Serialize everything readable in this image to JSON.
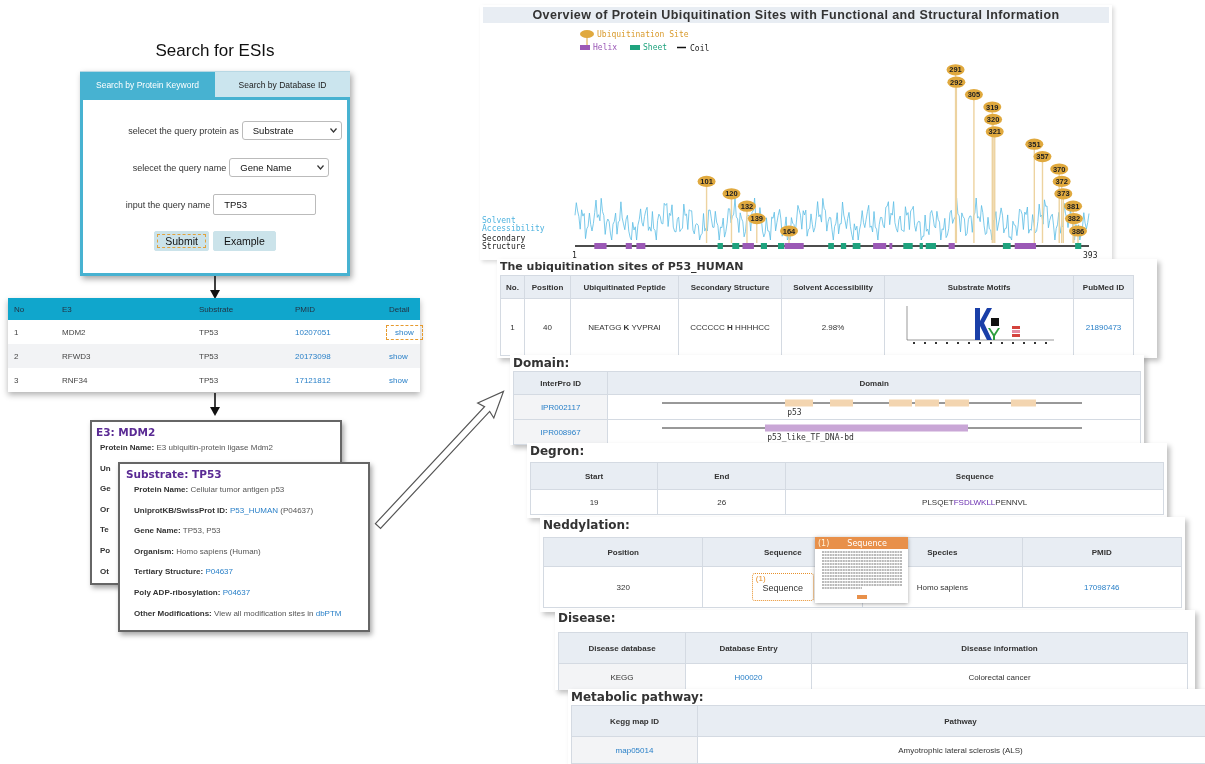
{
  "figure_title": "Search for ESIs",
  "search_panel": {
    "tabs": [
      {
        "label": "Search by Protein Keyword",
        "selected": true
      },
      {
        "label": "Search by Database ID",
        "selected": false
      }
    ],
    "fields": [
      {
        "kind": "select",
        "label": "selecet the query protein as",
        "value": "Substrate"
      },
      {
        "kind": "select",
        "label": "selecet the query name",
        "value": "Gene Name"
      },
      {
        "kind": "input",
        "label": "input the query name",
        "value": "TP53"
      }
    ],
    "buttons": [
      {
        "label": "Submit",
        "highlighted": true
      },
      {
        "label": "Example",
        "highlighted": false
      }
    ]
  },
  "results_table": {
    "columns": [
      "No",
      "E3",
      "Substrate",
      "PMID",
      "Detail"
    ],
    "rows": [
      [
        "1",
        "MDM2",
        "TP53",
        {
          "kind": "link",
          "text": "10207051",
          "highlighted": false
        },
        {
          "kind": "link",
          "text": "show",
          "highlighted": true
        }
      ],
      [
        "2",
        "RFWD3",
        "TP53",
        {
          "kind": "link",
          "text": "20173098",
          "highlighted": false
        },
        {
          "kind": "link",
          "text": "show",
          "highlighted": false
        }
      ],
      [
        "3",
        "RNF34",
        "TP53",
        {
          "kind": "link",
          "text": "17121812",
          "highlighted": false
        },
        {
          "kind": "link",
          "text": "show",
          "highlighted": false
        }
      ]
    ]
  },
  "cards": [
    {
      "title": "E3: MDM2",
      "fields": [
        {
          "label": "Protein Name:",
          "value": "E3 ubiquitin-protein ligase Mdm2"
        },
        {
          "label": "Un"
        },
        {
          "label": "Ge"
        },
        {
          "label": "Or"
        },
        {
          "label": "Te"
        },
        {
          "label": "Po"
        },
        {
          "label": "Ot"
        }
      ]
    },
    {
      "title": "Substrate: TP53",
      "fields": [
        {
          "label": "Protein Name:",
          "value": "Cellular tumor antigen p53"
        },
        {
          "label": "UniprotKB/SwissProt ID:",
          "link": "P53_HUMAN",
          "suffix": "(P04637)"
        },
        {
          "label": "Gene Name:",
          "value": "TP53, P53"
        },
        {
          "label": "Organism:",
          "value": "Homo sapiens (Human)"
        },
        {
          "label": "Tertiary Structure:",
          "link": "P04637"
        },
        {
          "label": "Poly ADP-ribosylation:",
          "link": "P04637"
        },
        {
          "label": "Other Modifications:",
          "value": "View all modification sites in",
          "link": "dbPTM"
        }
      ]
    }
  ],
  "chart": {
    "title": "Overview of Protein Ubiquitination Sites with Functional and Structural Information",
    "legend": [
      {
        "kind": "site",
        "label": "Ubiquitination Site"
      },
      {
        "kind": "helix",
        "label": "Helix"
      },
      {
        "kind": "sheet",
        "label": "Sheet"
      },
      {
        "kind": "coil",
        "label": "Coil"
      }
    ],
    "y_labels": [
      {
        "kind": "accessibility",
        "label": "Solvent Accessibility"
      },
      {
        "kind": "structure",
        "label": "Secondary Structure"
      }
    ],
    "axis_start": "1",
    "axis_end": "393",
    "sites": [
      "101",
      "120",
      "132",
      "139",
      "164",
      "291",
      "292",
      "305",
      "319",
      "320",
      "321",
      "351",
      "357",
      "370",
      "372",
      "373",
      "381",
      "382",
      "386"
    ]
  },
  "detail_panels": [
    {
      "title": "The ubiquitination sites of P53_HUMAN",
      "columns": [
        "No.",
        "Position",
        "Ubiquitinated Peptide",
        "Secondary Structure",
        "Solvent Accessibility",
        "Substrate Motifs",
        "PubMed ID"
      ],
      "rows": [
        [
          "1",
          "40",
          "NEATGG **K** YVPRAI",
          "CCCCCC **H** HHHHCC",
          "2.98%",
          {
            "kind": "motif"
          },
          {
            "kind": "link",
            "text": "21890473",
            "highlighted": false
          }
        ]
      ]
    },
    {
      "title": "Domain:",
      "columns": [
        "InterPro ID",
        "Domain"
      ],
      "rows": [
        [
          {
            "kind": "link",
            "text": "IPR002117",
            "highlighted": false
          },
          {
            "kind": "domain_repeats",
            "label": "p53"
          }
        ],
        [
          {
            "kind": "link",
            "text": "IPR008967",
            "highlighted": false
          },
          {
            "kind": "domain_bar",
            "label": "p53_like_TF_DNA-bd"
          }
        ]
      ]
    },
    {
      "title": "Degron:",
      "columns": [
        "Start",
        "End",
        "Sequence"
      ],
      "rows": [
        [
          "19",
          "26",
          {
            "kind": "segments",
            "parts": [
              {
                "text": "PLSQET",
                "highlight": false
              },
              {
                "text": "FSDLWKLL",
                "highlight": true
              },
              {
                "text": "PENNVL",
                "highlight": false
              }
            ]
          }
        ]
      ]
    },
    {
      "title": "Neddylation:",
      "columns": [
        "Position",
        "Sequence",
        "Species",
        "PMID"
      ],
      "rows": [
        [
          "320",
          {
            "kind": "popup_link",
            "marker": "(1)",
            "text": "Sequence",
            "highlighted": true
          },
          "Homo sapiens",
          {
            "kind": "link",
            "text": "17098746",
            "highlighted": false
          }
        ]
      ],
      "popup": {
        "marker": "(1)",
        "title": "Sequence"
      }
    },
    {
      "title": "Disease:",
      "columns": [
        "Disease database",
        "Database Entry",
        "Disease information"
      ],
      "rows": [
        [
          "KEGG",
          {
            "kind": "link",
            "text": "H00020",
            "highlighted": false
          },
          "Colorectal cancer"
        ]
      ]
    },
    {
      "title": "Metabolic pathway:",
      "columns": [
        "Kegg map ID",
        "Pathway"
      ],
      "rows": [
        [
          {
            "kind": "link",
            "text": "map05014",
            "highlighted": false
          },
          "Amyotrophic lateral sclerosis (ALS)"
        ]
      ]
    }
  ]
}
